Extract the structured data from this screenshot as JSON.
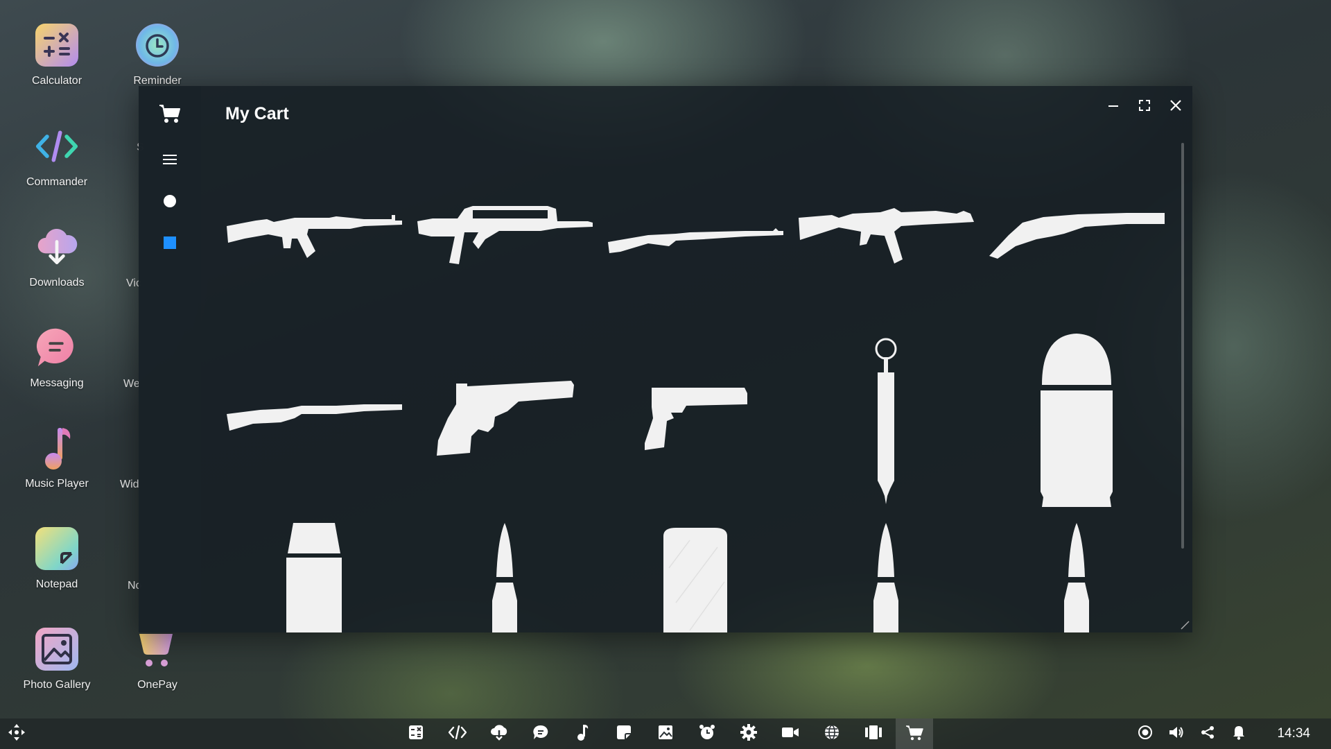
{
  "desktop": {
    "icons": [
      {
        "label": "Calculator",
        "icon": "calculator-icon"
      },
      {
        "label": "Reminder",
        "icon": "alarm-clock-icon"
      },
      {
        "label": "Commander",
        "icon": "code-icon"
      },
      {
        "label": "Downloads",
        "icon": "cloud-download-icon"
      },
      {
        "label": "Messaging",
        "icon": "chat-bubble-icon"
      },
      {
        "label": "Music Player",
        "icon": "music-note-icon"
      },
      {
        "label": "Notepad",
        "icon": "sticky-note-icon"
      },
      {
        "label": "Photo Gallery",
        "icon": "photo-icon"
      },
      {
        "label": "OnePay",
        "icon": "shopping-cart-icon"
      }
    ],
    "partial_labels": [
      "S",
      "S",
      "Vic",
      "We",
      "Wid",
      "No"
    ]
  },
  "window": {
    "title": "My Cart",
    "sidebar": [
      "cart-icon",
      "menu-icon",
      "circle-icon",
      "square-icon"
    ],
    "controls": [
      "minimize",
      "maximize",
      "close"
    ],
    "items": [
      {
        "name": "assault-rifle-ak"
      },
      {
        "name": "bullpup-rifle"
      },
      {
        "name": "battle-rifle"
      },
      {
        "name": "submachine-gun"
      },
      {
        "name": "double-barrel-shotgun"
      },
      {
        "name": "pump-shotgun"
      },
      {
        "name": "revolver"
      },
      {
        "name": "pistol"
      },
      {
        "name": "syringe-grenade"
      },
      {
        "name": "large-round"
      },
      {
        "name": "short-cartridge"
      },
      {
        "name": "rifle-cartridge"
      },
      {
        "name": "shotgun-shell"
      },
      {
        "name": "rifle-cartridge"
      },
      {
        "name": "rifle-cartridge"
      }
    ]
  },
  "taskbar": {
    "apps": [
      "calculator",
      "commander",
      "downloads",
      "messaging",
      "music",
      "notepad",
      "gallery",
      "reminder",
      "settings",
      "video",
      "browser",
      "widgets",
      "cart"
    ],
    "tray": [
      "screen-record-icon",
      "volume-icon",
      "share-icon",
      "bell-icon"
    ],
    "clock": "14:34"
  },
  "colors": {
    "accent": "#1e90ff",
    "window_bg": "#161e24",
    "item_fill": "#f1f1f1"
  }
}
